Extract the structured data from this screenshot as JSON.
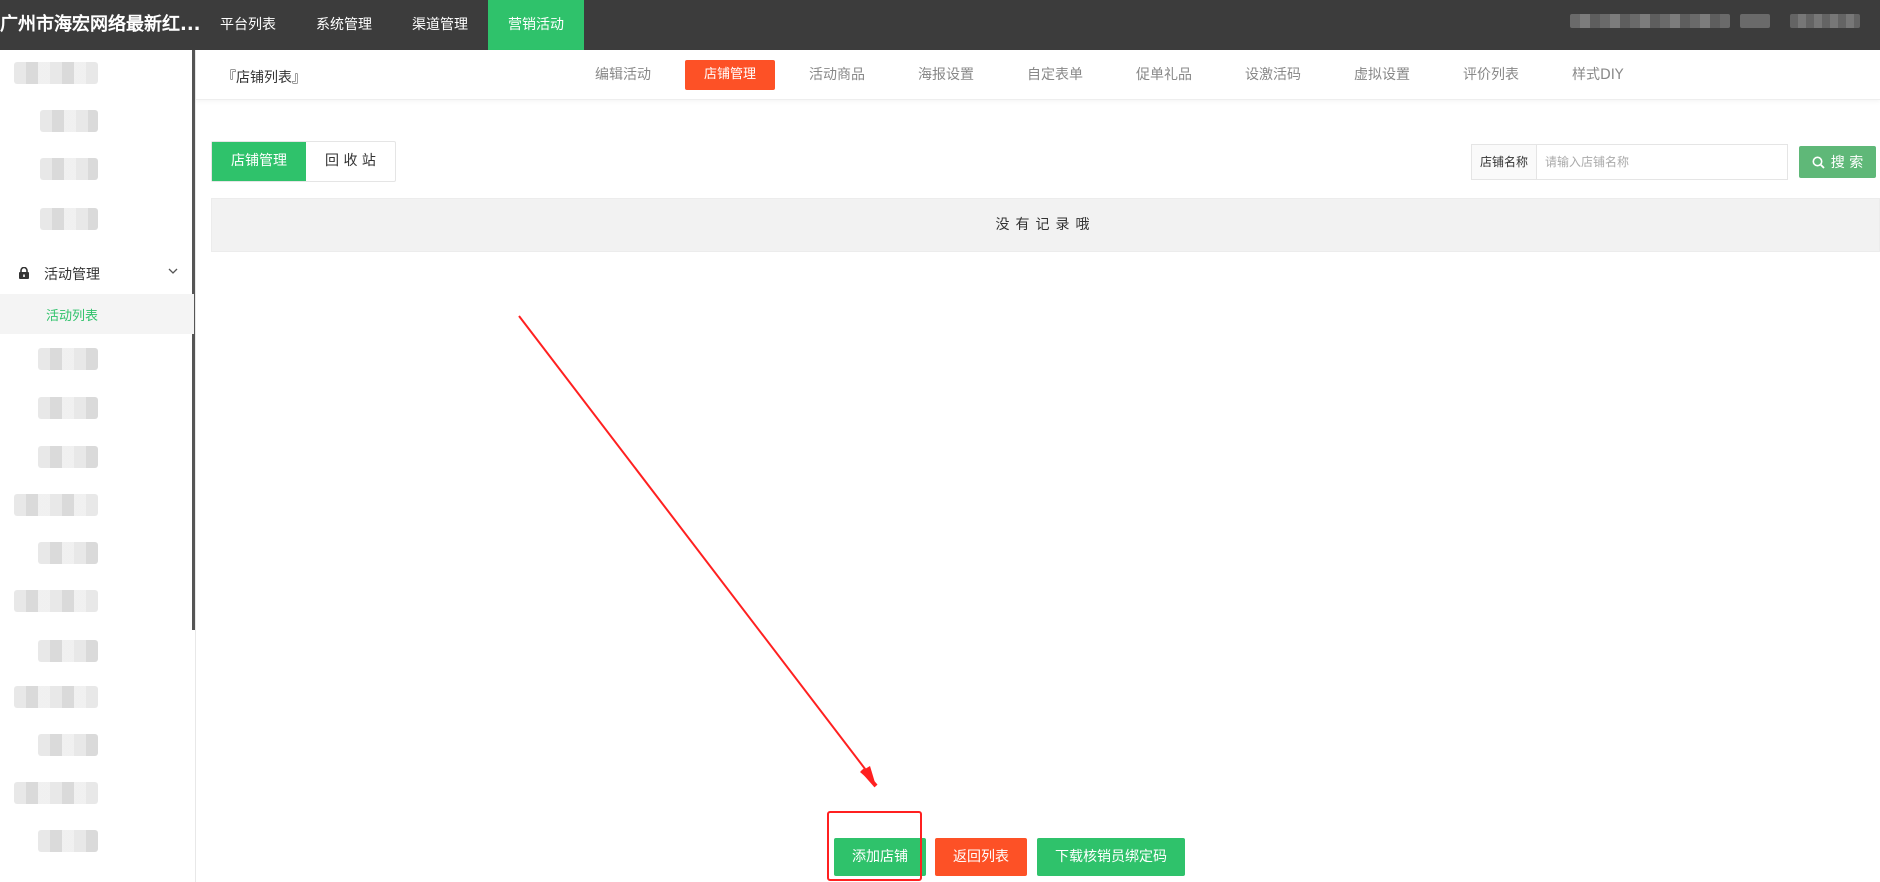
{
  "app": {
    "brand": "广州市海宏网络最新红..."
  },
  "topnav": {
    "items": [
      {
        "label": "平台列表"
      },
      {
        "label": "系统管理"
      },
      {
        "label": "渠道管理"
      },
      {
        "label": "营销活动",
        "active": true
      }
    ]
  },
  "sidebar": {
    "group_label": "活动管理",
    "active_item": "活动列表"
  },
  "subnav": {
    "breadcrumb": "『店铺列表』",
    "tabs": [
      {
        "label": "编辑活动"
      },
      {
        "label": "店铺管理",
        "active": true
      },
      {
        "label": "活动商品"
      },
      {
        "label": "海报设置"
      },
      {
        "label": "自定表单"
      },
      {
        "label": "促单礼品"
      },
      {
        "label": "设激活码"
      },
      {
        "label": "虚拟设置"
      },
      {
        "label": "评价列表"
      },
      {
        "label": "样式DIY"
      }
    ]
  },
  "tabs": {
    "store_manage": "店铺管理",
    "recycle_bin": "回 收 站"
  },
  "search": {
    "label": "店铺名称",
    "placeholder": "请输入店铺名称",
    "value": "",
    "button_label": "搜 索"
  },
  "table": {
    "empty_text": "没有记录哦"
  },
  "actions": {
    "add_store": "添加店铺",
    "back_to_list": "返回列表",
    "download_code": "下载核销员绑定码"
  },
  "colors": {
    "topbar": "#3c3c3c",
    "primary_green": "#2fc26b",
    "accent_orange": "#fd5126",
    "search_green": "#5fb878",
    "annotation_red": "#ff2020"
  }
}
